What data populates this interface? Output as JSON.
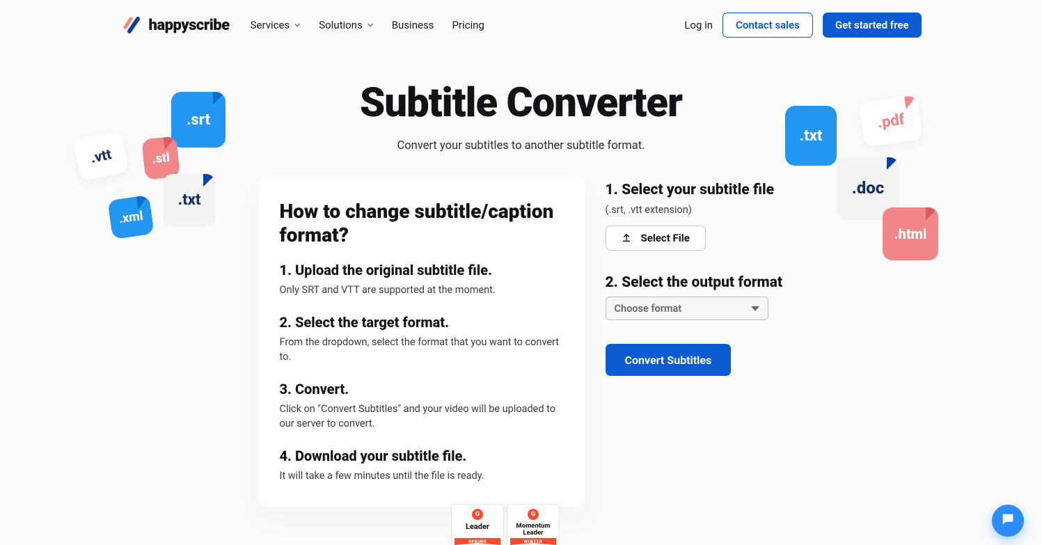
{
  "brand": {
    "name": "happyscribe"
  },
  "nav": {
    "links": [
      {
        "label": "Services",
        "hasChevron": true
      },
      {
        "label": "Solutions",
        "hasChevron": true
      },
      {
        "label": "Business",
        "hasChevron": false
      },
      {
        "label": "Pricing",
        "hasChevron": false
      }
    ],
    "login": "Log in",
    "contact": "Contact sales",
    "cta": "Get started free"
  },
  "hero": {
    "title": "Subtitle Converter",
    "subtitle": "Convert your subtitles to another subtitle format."
  },
  "chips": {
    "srt": ".srt",
    "vtt": ".vtt",
    "stl": ".stl",
    "txtL": ".txt",
    "xml": ".xml",
    "txtR": ".txt",
    "pdf": ".pdf",
    "doc": ".doc",
    "html": ".html"
  },
  "howto": {
    "title": "How to change subtitle/caption format?",
    "steps": [
      {
        "title": "1. Upload the original subtitle file.",
        "desc": "Only SRT and VTT are supported at the moment."
      },
      {
        "title": "2. Select the target format.",
        "desc": "From the dropdown, select the format that you want to convert to."
      },
      {
        "title": "3. Convert.",
        "desc": "Click on \"Convert Subtitles\" and your video will be uploaded to our server to convert."
      },
      {
        "title": "4. Download your subtitle file.",
        "desc": "It will take a few minutes until the file is ready."
      }
    ]
  },
  "panel": {
    "step1_title": "1.  Select your subtitle file",
    "step1_hint": "(.srt, .vtt extension)",
    "select_file": "Select File",
    "step2_title": "2. Select the output format",
    "format_placeholder": "Choose format",
    "convert": "Convert Subtitles"
  },
  "badges": {
    "leader": {
      "title": "Leader",
      "period": "SPRING"
    },
    "momentum": {
      "title": "Momentum Leader",
      "period": "WINTER"
    }
  }
}
